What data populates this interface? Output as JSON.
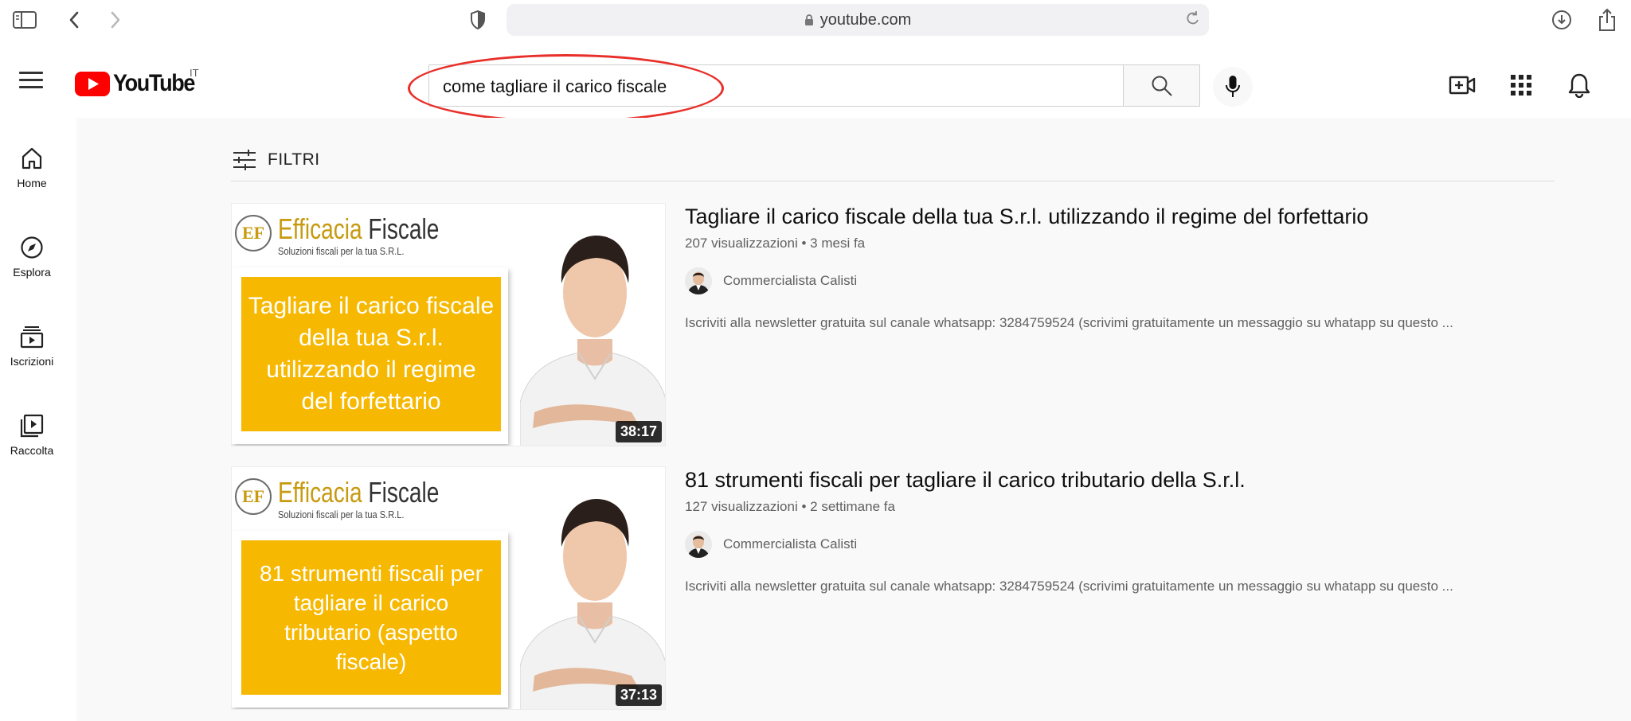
{
  "browser": {
    "url": "youtube.com"
  },
  "header": {
    "logo_text": "YouTube",
    "country_code": "IT",
    "search_value": "come tagliare il carico fiscale"
  },
  "guide": [
    {
      "label": "Home",
      "icon": "home-icon"
    },
    {
      "label": "Esplora",
      "icon": "compass-icon"
    },
    {
      "label": "Iscrizioni",
      "icon": "subscriptions-icon"
    },
    {
      "label": "Raccolta",
      "icon": "library-icon"
    }
  ],
  "filters_label": "FILTRI",
  "results": [
    {
      "title": "Tagliare il carico fiscale della tua S.r.l. utilizzando il regime del forfettario",
      "views": "207 visualizzazioni",
      "age": "3 mesi fa",
      "channel": "Commercialista Calisti",
      "description": "Iscriviti alla newsletter gratuita sul canale whatsapp: 3284759524 (scrivimi gratuitamente un messaggio su whatapp su questo ...",
      "duration": "38:17",
      "thumb_brand_1": "Efficacia",
      "thumb_brand_2": "Fiscale",
      "thumb_brand_sub": "Soluzioni fiscali per la tua S.R.L.",
      "thumb_text": "Tagliare il carico fiscale della tua S.r.l. utilizzando il regime del forfettario"
    },
    {
      "title": "81 strumenti fiscali per tagliare il carico tributario della S.r.l.",
      "views": "127 visualizzazioni",
      "age": "2 settimane fa",
      "channel": "Commercialista Calisti",
      "description": "Iscriviti alla newsletter gratuita sul canale whatsapp: 3284759524 (scrivimi gratuitamente un messaggio su whatapp su questo ...",
      "duration": "37:13",
      "thumb_brand_1": "Efficacia",
      "thumb_brand_2": "Fiscale",
      "thumb_brand_sub": "Soluzioni fiscali per la tua S.R.L.",
      "thumb_text": "81 strumenti fiscali per tagliare il carico tributario (aspetto fiscale)"
    }
  ],
  "colors": {
    "youtube_red": "#ff0000",
    "thumb_yellow": "#f6b800",
    "annotation_red": "#e8302a"
  }
}
